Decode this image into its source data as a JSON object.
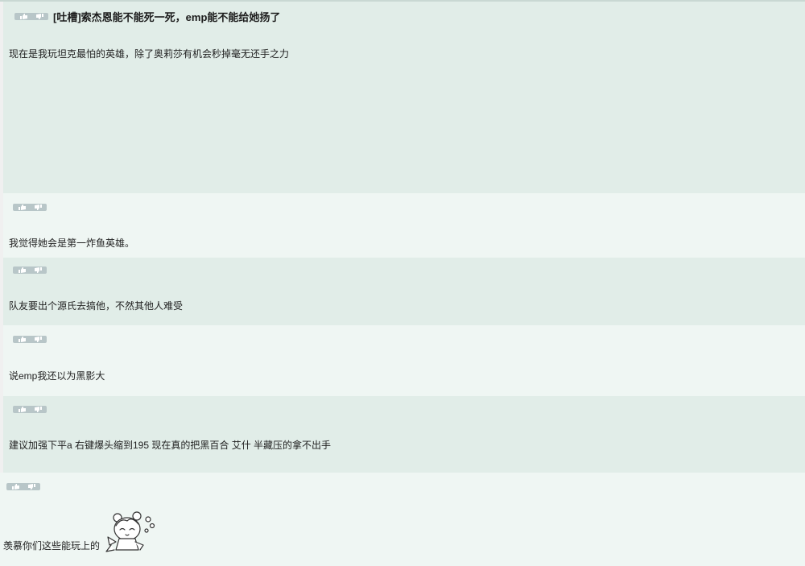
{
  "thread": {
    "title": "[吐槽]索杰恩能不能死一死，emp能不能给她扬了"
  },
  "posts": [
    {
      "body": "现在是我玩坦克最怕的英雄，除了奥莉莎有机会秒掉毫无还手之力"
    },
    {
      "body": "我觉得她会是第一炸鱼英雄。"
    },
    {
      "body": "队友要出个源氏去搞他，不然其他人难受"
    },
    {
      "body": "说emp我还以为黑影大"
    },
    {
      "body": "建议加强下平a 右键爆头缩到195 现在真的把黑百合 艾什 半藏压的拿不出手"
    },
    {
      "body": "羡慕你们这些能玩上的"
    }
  ],
  "icons": {
    "upvote": "thumb-up-icon",
    "downvote": "thumb-down-icon",
    "sticker": "chibi-girl-sweat-sticker"
  },
  "colors": {
    "post_dark": "#e1ede8",
    "post_light": "#eff6f3",
    "vote_bg": "#b8c6c8",
    "top_border": "#c9d8d3"
  }
}
